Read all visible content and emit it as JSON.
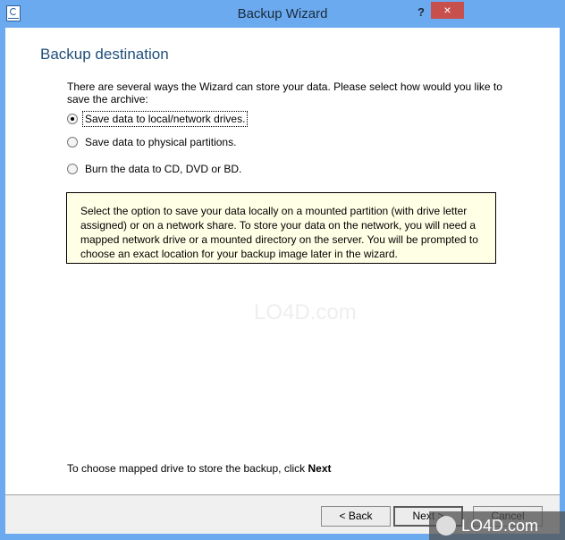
{
  "window": {
    "title": "Backup Wizard",
    "help_label": "?",
    "close_label": "×"
  },
  "page": {
    "title": "Backup destination",
    "intro": "There are several ways the Wizard can store your data. Please select how would you like to save the archive:",
    "options": [
      {
        "label": "Save data to local/network drives.",
        "checked": true
      },
      {
        "label": "Save data to physical partitions.",
        "checked": false
      },
      {
        "label": "Burn the data to CD, DVD or BD.",
        "checked": false
      }
    ],
    "info": "Select the option to save your data locally on a mounted partition (with drive letter assigned) or on a network share. To store your data on the network, you will need a mapped network drive or a mounted directory on the server. You will be prompted to choose an exact location for your backup image later in the wizard.",
    "hint_prefix": "To choose mapped drive to store the backup, click ",
    "hint_bold": "Next"
  },
  "buttons": {
    "back": "< Back",
    "next": "Next >",
    "cancel": "Cancel"
  },
  "watermark": {
    "text": "LO4D.com"
  }
}
